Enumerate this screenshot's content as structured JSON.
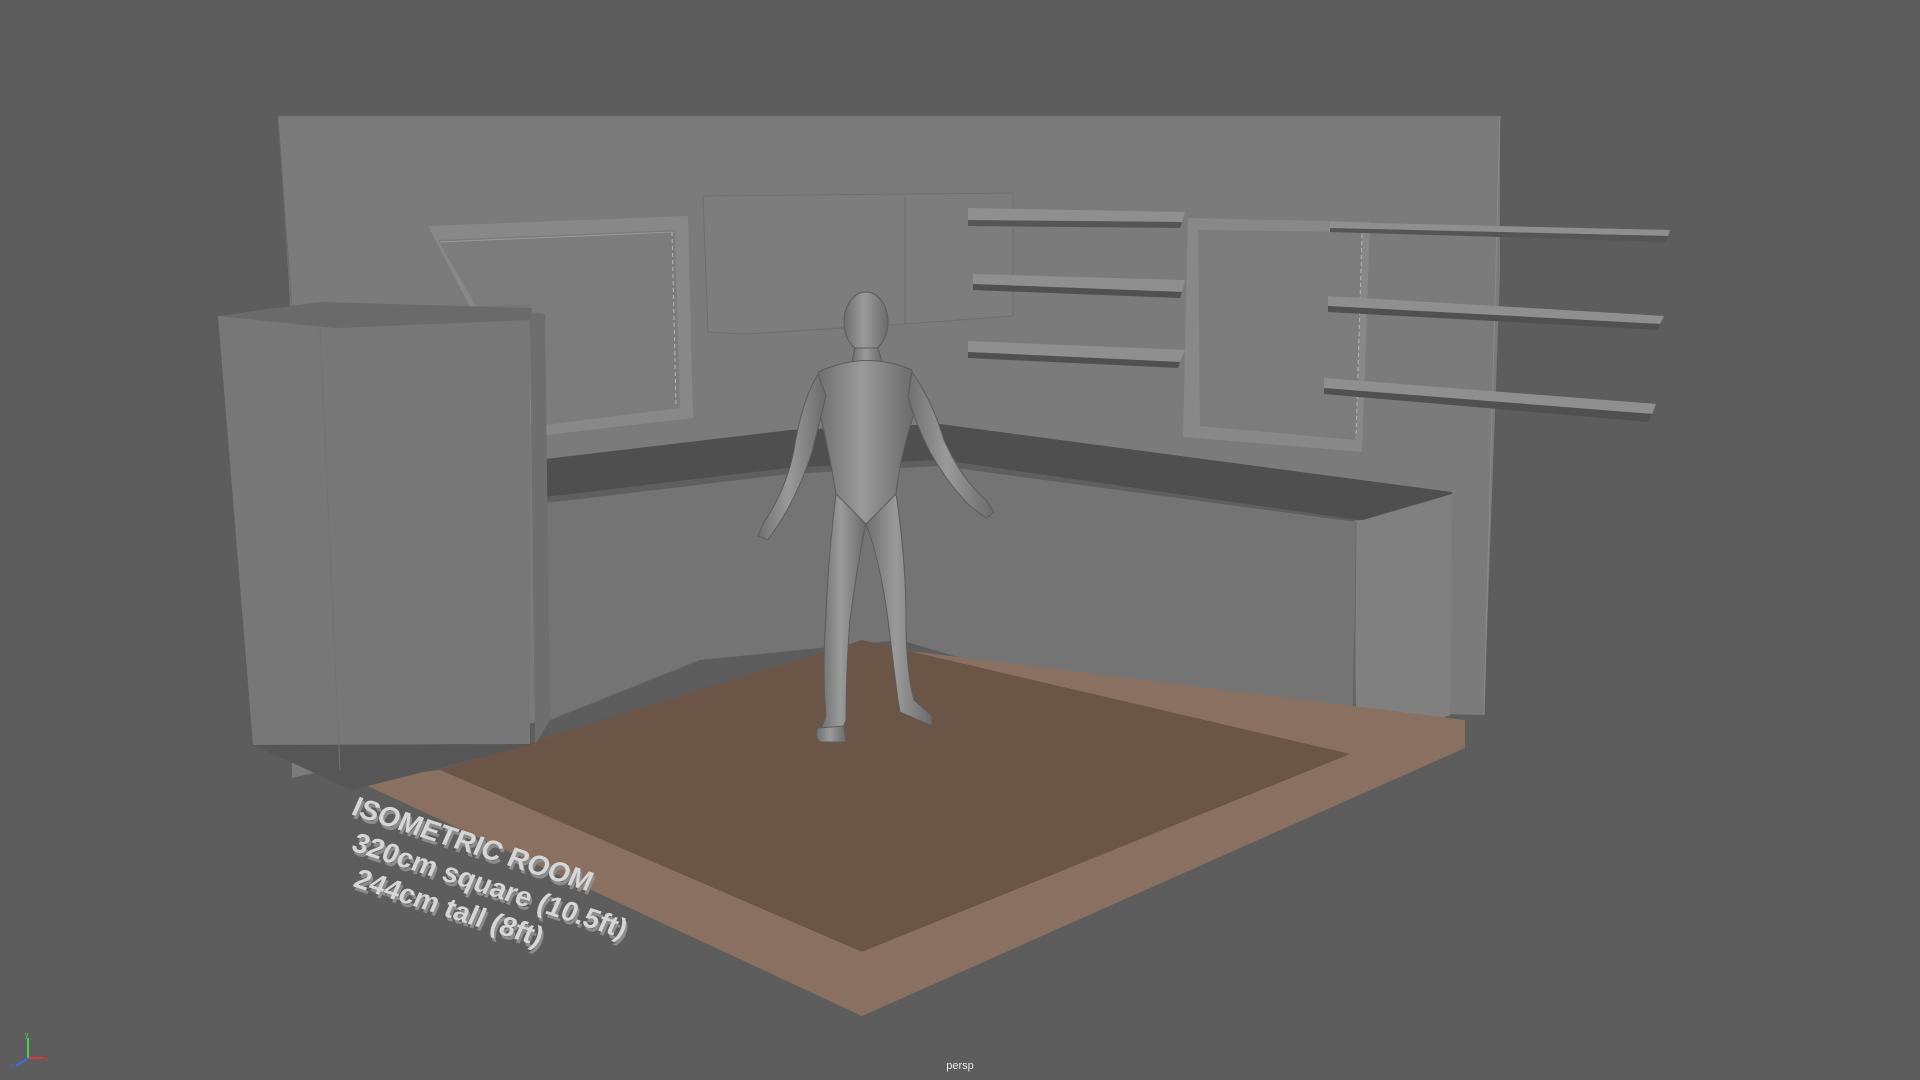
{
  "viewport": {
    "camera_label": "persp",
    "background_color": "#5d5d5d"
  },
  "annotation": {
    "line1": "ISOMETRIC ROOM",
    "line2": "320cm square (10.5ft)",
    "line3": "244cm tall (8ft)"
  },
  "axis_gizmo": {
    "x_label": "x",
    "y_label": "y",
    "z_label": "z",
    "x_color": "#d33a3a",
    "y_color": "#4fd14f",
    "z_color": "#3a6fe0"
  },
  "colors": {
    "floor_top": "#6b5547",
    "floor_edge": "#8a7060",
    "wall": "#7b7b7b",
    "shelf": "#7a7a7a",
    "figure": "#8a8a8a"
  }
}
